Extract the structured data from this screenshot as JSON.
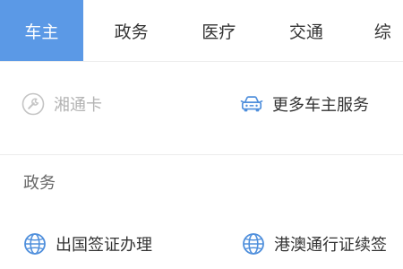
{
  "tabs": [
    {
      "label": "车主",
      "active": true
    },
    {
      "label": "政务",
      "active": false
    },
    {
      "label": "医疗",
      "active": false
    },
    {
      "label": "交通",
      "active": false
    },
    {
      "label": "综",
      "active": false
    }
  ],
  "car_section": {
    "items": [
      {
        "label": "湘通卡",
        "icon": "wrench-icon",
        "disabled": true
      },
      {
        "label": "更多车主服务",
        "icon": "car-icon",
        "disabled": false
      }
    ]
  },
  "gov_section": {
    "title": "政务",
    "items": [
      {
        "label": "出国签证办理",
        "icon": "globe-icon"
      },
      {
        "label": "港澳通行证续签",
        "icon": "globe-icon"
      }
    ]
  },
  "colors": {
    "accent": "#5b99e6",
    "icon_blue": "#4f8fdc",
    "disabled": "#b3b3b3",
    "text": "#333333"
  }
}
